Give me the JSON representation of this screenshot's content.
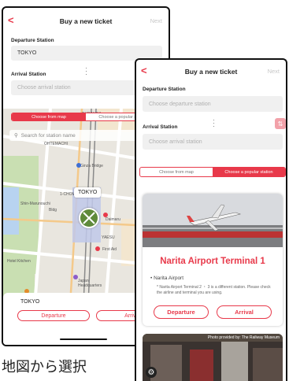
{
  "colors": {
    "accent": "#e8394a",
    "field_bg": "#f0f0f0",
    "placeholder": "#b0b0b0"
  },
  "screen1": {
    "title": "Buy a new ticket",
    "next": "Next",
    "departure_label": "Departure Station",
    "departure_value": "TOKYO",
    "arrival_label": "Arrival Station",
    "arrival_placeholder": "Choose arrival station",
    "tabs": [
      "Choose from map",
      "Choose a popular station"
    ],
    "search_placeholder": "Search for station name",
    "map_labels": [
      "OHTEMACHI",
      "Ginza Bridge",
      "1-CHOME",
      "Shin-Marunouchi Building",
      "YAESU",
      "Daimaru",
      "First Aid",
      "KYOBASHI",
      "Hibiya Park",
      "Tokyo Station Hotel",
      "Imperial Palace",
      "Hotel Kitchen",
      "Hotel Cafe Japan Headquarters",
      "Gallery Museum",
      "DURANDA"
    ],
    "pin_label": "TOKYO",
    "selected_station": "TOKYO",
    "departure_button": "Departure",
    "arrival_button": "Arrival"
  },
  "screen2": {
    "title": "Buy a new ticket",
    "next": "Next",
    "departure_label": "Departure Station",
    "departure_placeholder": "Choose departure station",
    "arrival_label": "Arrival Station",
    "arrival_placeholder": "Choose arrival station",
    "tabs": [
      "Choose from map",
      "Choose a popular station"
    ],
    "card": {
      "title": "Narita Airport Terminal 1",
      "station": "Narita Airport",
      "note": "* Narita Airport Terminal 2 ・ 3 is a different station. Please check the airline and terminal you are using.",
      "departure_button": "Departure",
      "arrival_button": "Arrival"
    },
    "photo_credit": "Photo provided by: The Railway Museum"
  },
  "caption": "地図から選択"
}
